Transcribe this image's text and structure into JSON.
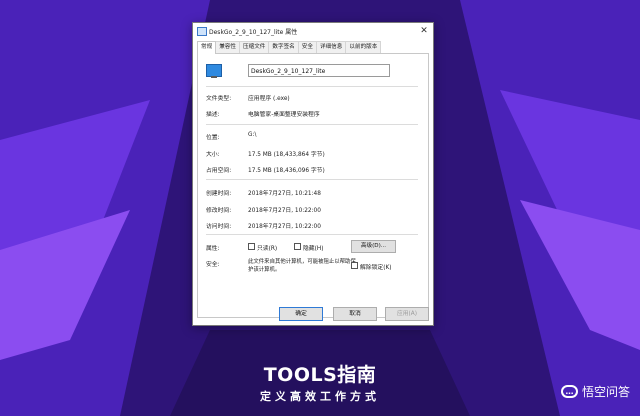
{
  "window": {
    "title": "DeskGo_2_9_10_127_lite 属性",
    "close_glyph": "✕"
  },
  "tabs": [
    {
      "label": "常规",
      "active": true
    },
    {
      "label": "兼容性"
    },
    {
      "label": "压缩文件"
    },
    {
      "label": "数字签名"
    },
    {
      "label": "安全"
    },
    {
      "label": "详细信息"
    },
    {
      "label": "以前的版本"
    }
  ],
  "general": {
    "file_name": "DeskGo_2_9_10_127_lite",
    "file_type_label": "文件类型:",
    "file_type_value": "应用程序 (.exe)",
    "description_label": "描述:",
    "description_value": "电脑管家-桌面整理安装程序",
    "location_label": "位置:",
    "location_value": "G:\\",
    "size_label": "大小:",
    "size_value": "17.5 MB (18,433,864 字节)",
    "size_on_disk_label": "占用空间:",
    "size_on_disk_value": "17.5 MB (18,436,096 字节)",
    "created_label": "创建时间:",
    "created_value": "2018年7月27日, 10:21:48",
    "modified_label": "修改时间:",
    "modified_value": "2018年7月27日, 10:22:00",
    "accessed_label": "访问时间:",
    "accessed_value": "2018年7月27日, 10:22:00",
    "attributes_label": "属性:",
    "readonly_label": "只读(R)",
    "hidden_label": "隐藏(H)",
    "advanced_button": "高级(D)...",
    "security_label": "安全:",
    "security_text": "此文件来自其他计算机，可能被阻止以帮助保护该计算机。",
    "unblock_label": "解除锁定(K)"
  },
  "buttons": {
    "ok": "确定",
    "cancel": "取消",
    "apply": "应用(A)"
  },
  "branding": {
    "title": "TOOLS指南",
    "subtitle": "定义高效工作方式",
    "watermark": "悟空问答"
  },
  "colors": {
    "background": "#3a1690",
    "accent": "#7a3cf0"
  }
}
